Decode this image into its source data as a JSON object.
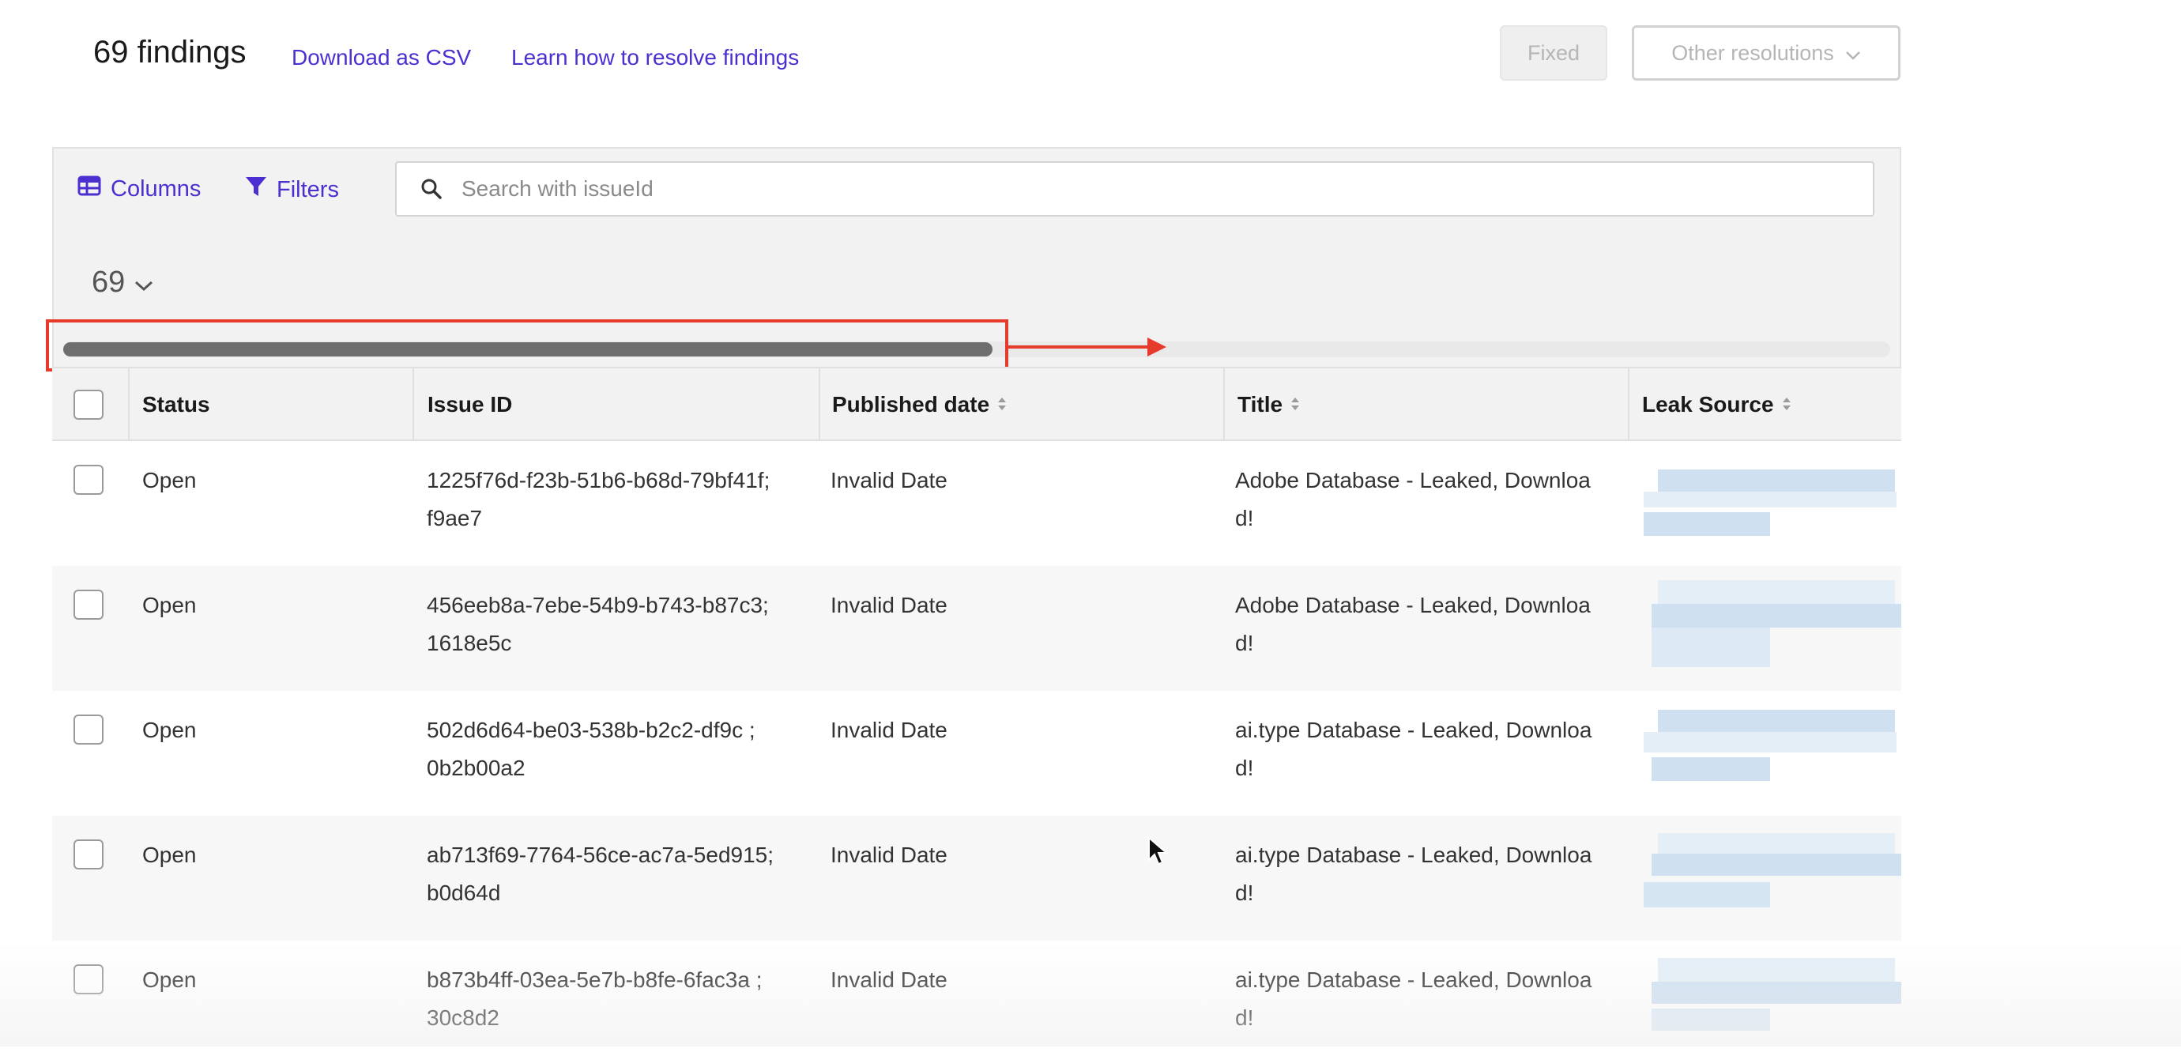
{
  "header": {
    "findings_count": "69 findings",
    "download_link": "Download as CSV",
    "learn_link": "Learn how to resolve findings",
    "fixed_button": "Fixed",
    "other_resolutions_button": "Other resolutions"
  },
  "toolbar": {
    "columns_label": "Columns",
    "filters_label": "Filters",
    "search_placeholder": "Search with issueId"
  },
  "pagination": {
    "page_size": "69"
  },
  "table": {
    "columns": [
      "Status",
      "Issue ID",
      "Published date",
      "Title",
      "Leak Source"
    ],
    "rows": [
      {
        "status": "Open",
        "issue_id_1": "1225f76d-f23b-51b6-b68d-79bf41f;",
        "issue_id_2": "f9ae7",
        "published": "Invalid Date",
        "title_1": "Adobe Database - Leaked, Downloa",
        "title_2": "d!"
      },
      {
        "status": "Open",
        "issue_id_1": "456eeb8a-7ebe-54b9-b743-b87c3;",
        "issue_id_2": "1618e5c",
        "published": "Invalid Date",
        "title_1": "Adobe Database - Leaked, Downloa",
        "title_2": "d!"
      },
      {
        "status": "Open",
        "issue_id_1": "502d6d64-be03-538b-b2c2-df9c ;",
        "issue_id_2": "0b2b00a2",
        "published": "Invalid Date",
        "title_1": "ai.type Database - Leaked, Downloa",
        "title_2": "d!"
      },
      {
        "status": "Open",
        "issue_id_1": "ab713f69-7764-56ce-ac7a-5ed915;",
        "issue_id_2": "b0d64d",
        "published": "Invalid Date",
        "title_1": "ai.type Database - Leaked, Downloa",
        "title_2": "d!"
      },
      {
        "status": "Open",
        "issue_id_1": "b873b4ff-03ea-5e7b-b8fe-6fac3a ;",
        "issue_id_2": "30c8d2",
        "published": "Invalid Date",
        "title_1": "ai.type Database - Leaked, Downloa",
        "title_2": "d!"
      }
    ]
  },
  "icons": {
    "columns": "table-columns-icon",
    "filters": "funnel-icon",
    "search": "search-icon",
    "dropdown": "chevron-down-icon",
    "sort": "sort-icon",
    "cursor": "mouse-cursor-icon"
  },
  "colors": {
    "accent": "#4d2fd1",
    "annotation": "#e63a2a",
    "panel_bg": "#f2f2f2",
    "blurred_link": "#c8dcef"
  }
}
